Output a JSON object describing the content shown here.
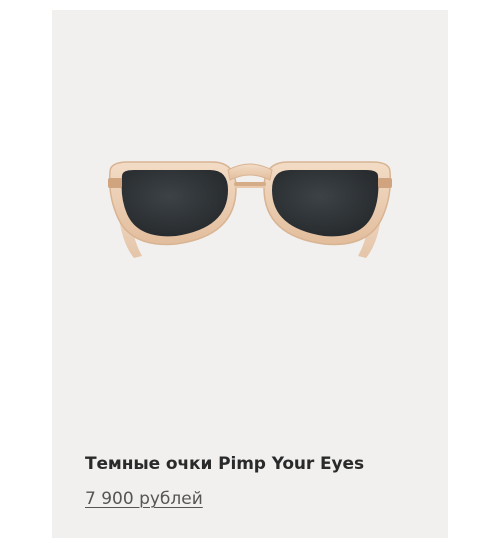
{
  "product": {
    "title": "Темные очки Pimp Your Eyes",
    "price": "7 900 рублей",
    "image_icon": "sunglasses-image"
  },
  "colors": {
    "card_background": "#f1f0ef",
    "frame": "#e9c9ac",
    "lens": "#2f3336",
    "title_text": "#2a2a2a",
    "price_text": "#555555"
  }
}
